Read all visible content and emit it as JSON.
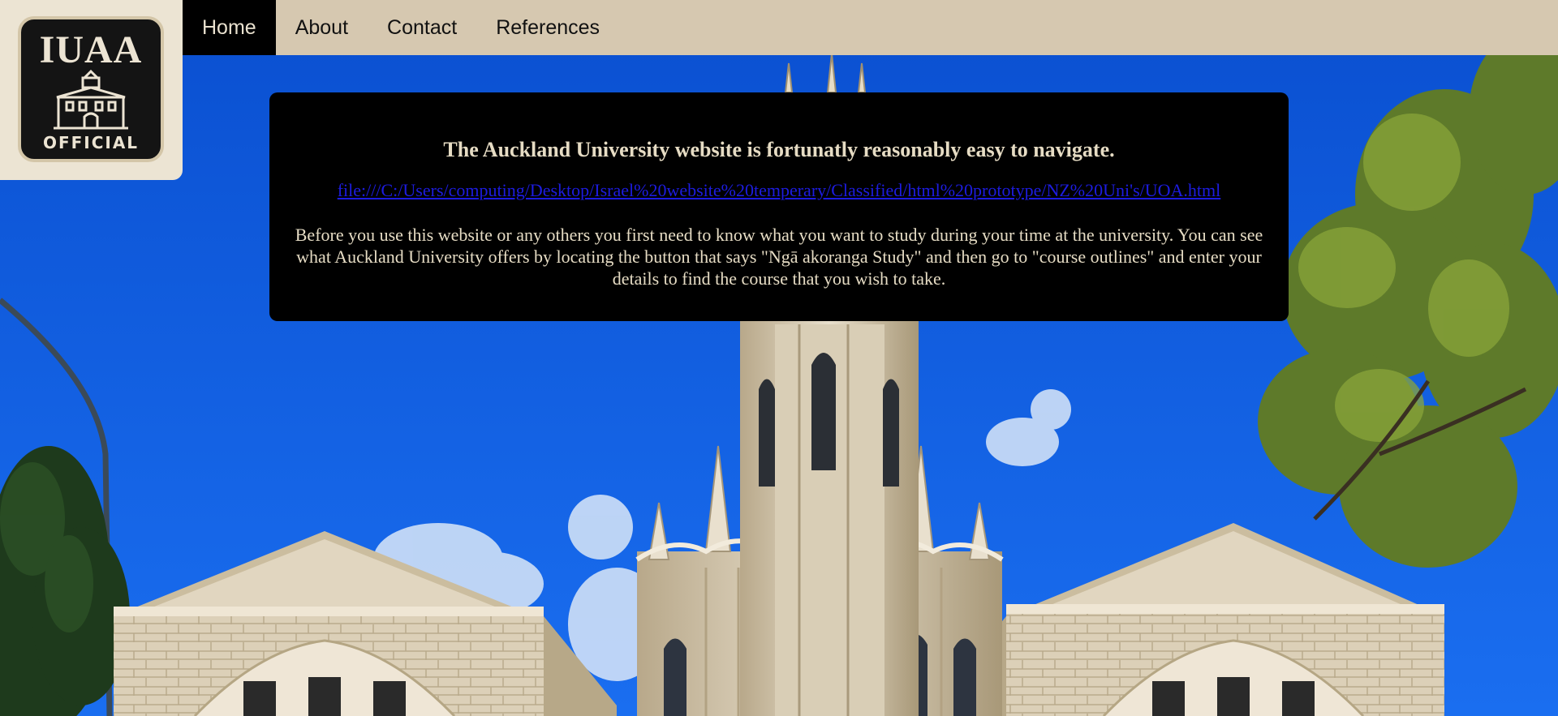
{
  "logo": {
    "title": "IUAA",
    "subtitle": "OFFICIAL",
    "building_icon": "university-building-icon"
  },
  "nav": {
    "items": [
      {
        "label": "Home",
        "active": true
      },
      {
        "label": "About",
        "active": false
      },
      {
        "label": "Contact",
        "active": false
      },
      {
        "label": "References",
        "active": false
      }
    ]
  },
  "info": {
    "heading": "The Auckland University website is fortunatly reasonably easy to navigate.",
    "link": "file:///C:/Users/computing/Desktop/Israel%20website%20temperary/Classified/html%20prototype/NZ%20Uni's/UOA.html",
    "body": "Before you use this website or any others you first need to know what you want to study during your time at the university. You can see what Auckland University offers by locating the button that says \"Ngā akoranga Study\" and then go to \"course outlines\" and enter your details to find the course that you wish to take."
  },
  "colors": {
    "nav_background": "#d6c8b0",
    "nav_active": "#000000",
    "logo_card": "#ece4d3",
    "info_background": "#000000",
    "info_text": "#e6dcc4",
    "link": "#1d1ce0",
    "sky": "#0b56d6"
  }
}
